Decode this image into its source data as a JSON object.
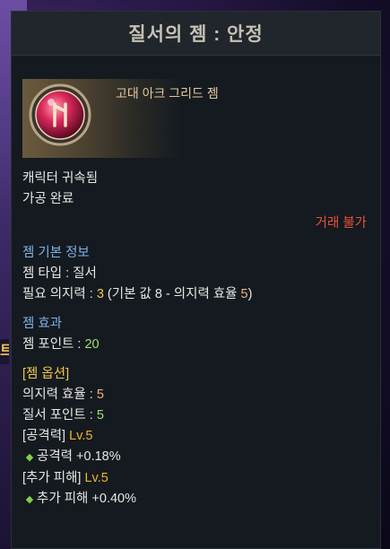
{
  "left_edge_char": "트",
  "tooltip": {
    "title": "질서의 젬 : 안정",
    "grade_name": "고대 아크 그리드 젬",
    "status_lines": [
      "캐릭터 귀속됨",
      "가공 완료"
    ],
    "trade_status": "거래 불가",
    "basic_info": {
      "title": "젬 기본 정보",
      "type_line": "젬 타입 : 질서",
      "will_label": "필요 의지력 : ",
      "will_value": "3",
      "will_detail_prefix": " (기본 값 8 - 의지력 효율 ",
      "will_efficiency": "5",
      "will_detail_suffix": ")"
    },
    "effect": {
      "title": "젬 효과",
      "point_label": "젬 포인트 : ",
      "point_value": "20"
    },
    "options": {
      "title": "[젬 옵션]",
      "will_eff_label": "의지력 효율 : ",
      "will_eff_value": "5",
      "order_point_label": "질서 포인트 : ",
      "order_point_value": "5",
      "attack_name": "[공격력]",
      "attack_level": "Lv.5",
      "attack_effect": "공격력 +0.18%",
      "extra_damage_name": "[추가 피해]",
      "extra_damage_level": "Lv.5",
      "extra_damage_effect": "추가 피해 +0.40%"
    }
  },
  "colors": {
    "section_title": "#7fb2e8",
    "gold": "#f2c74a",
    "trade": "#e8503a",
    "green": "#9fe06a",
    "orange": "#f0b27a"
  }
}
